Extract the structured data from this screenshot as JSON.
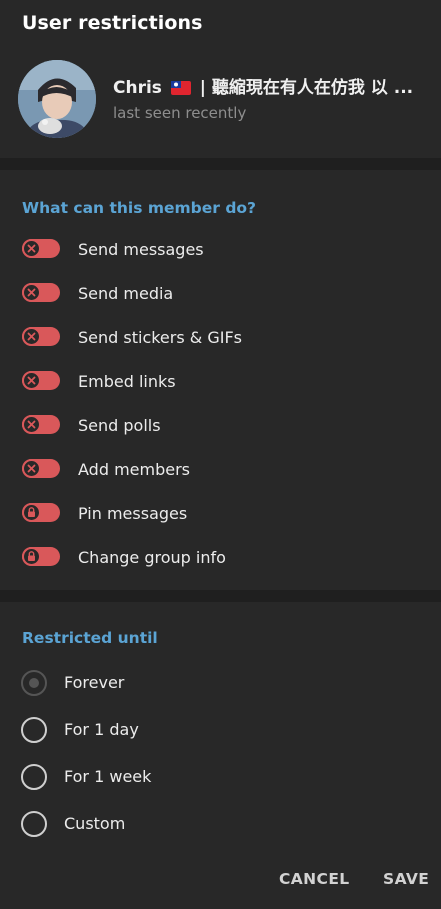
{
  "dialog": {
    "title": "User restrictions"
  },
  "user": {
    "name_prefix": "Chris",
    "name_suffix": "| 聽縮現在有人在仿我 以 ...",
    "status": "last seen recently"
  },
  "permissions": {
    "section_title": "What can this member do?",
    "items": [
      {
        "label": "Send messages",
        "icon": "x-icon",
        "enabled": false
      },
      {
        "label": "Send media",
        "icon": "x-icon",
        "enabled": false
      },
      {
        "label": "Send stickers & GIFs",
        "icon": "x-icon",
        "enabled": false
      },
      {
        "label": "Embed links",
        "icon": "x-icon",
        "enabled": false
      },
      {
        "label": "Send polls",
        "icon": "x-icon",
        "enabled": false
      },
      {
        "label": "Add members",
        "icon": "x-icon",
        "enabled": false
      },
      {
        "label": "Pin messages",
        "icon": "lock-icon",
        "enabled": false
      },
      {
        "label": "Change group info",
        "icon": "lock-icon",
        "enabled": false
      }
    ]
  },
  "restriction": {
    "section_title": "Restricted until",
    "options": [
      {
        "label": "Forever",
        "selected": true
      },
      {
        "label": "For 1 day",
        "selected": false
      },
      {
        "label": "For 1 week",
        "selected": false
      },
      {
        "label": "Custom",
        "selected": false
      }
    ]
  },
  "buttons": {
    "cancel": "CANCEL",
    "save": "SAVE"
  },
  "colors": {
    "background": "#282828",
    "divider": "#1f1f1f",
    "accent": "#5ba4d4",
    "toggle_off": "#d9585a"
  }
}
